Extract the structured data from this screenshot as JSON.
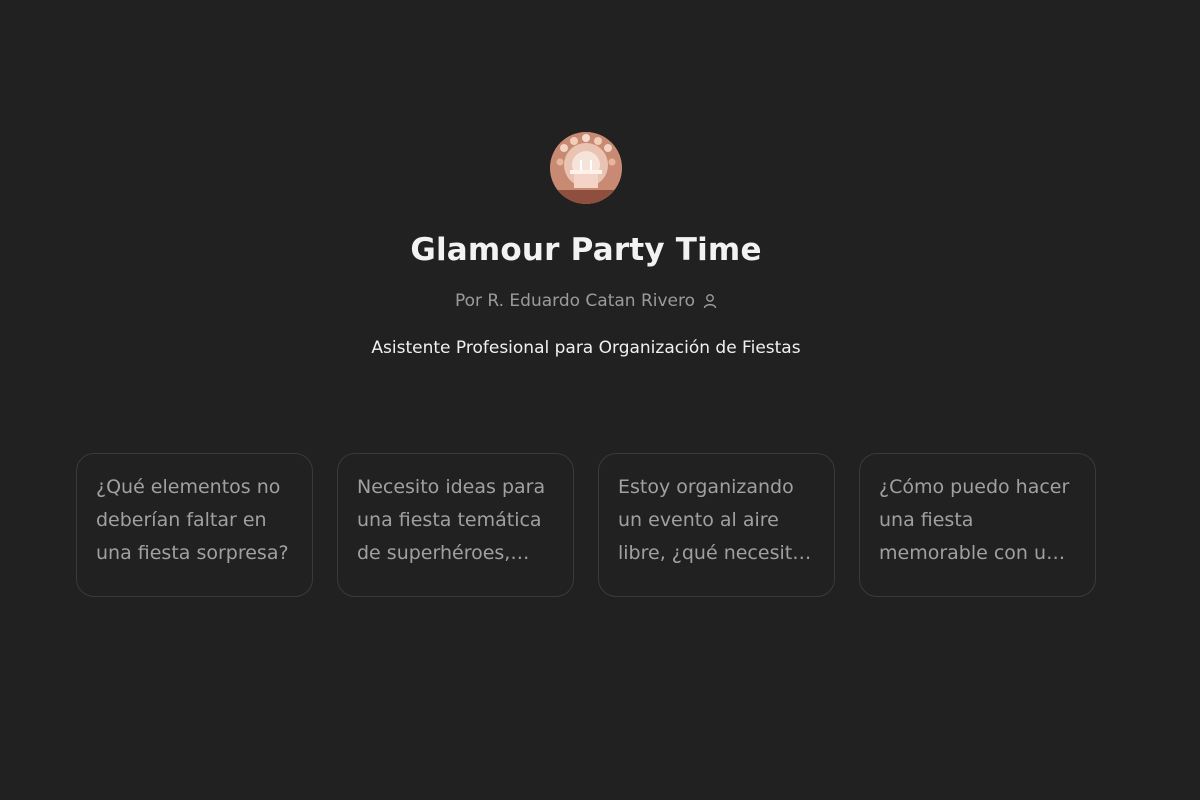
{
  "colors": {
    "background": "#212121",
    "title": "#f2f2f2",
    "muted": "#9b9b9b",
    "card_border": "#3a3a3a"
  },
  "gpt": {
    "avatar_icon": "party-table-avatar",
    "title": "Glamour Party Time",
    "author": "Por R. Eduardo Catan Rivero",
    "author_icon": "person-icon",
    "description": "Asistente Profesional para Organización de Fiestas"
  },
  "starters": [
    {
      "text": "¿Qué elementos no deberían faltar en una fiesta sorpresa?"
    },
    {
      "text": "Necesito ideas para una fiesta temática de superhéroes, ¿qué me recomiendas?"
    },
    {
      "text": "Estoy organizando un evento al aire libre, ¿qué necesito tener en cuenta?"
    },
    {
      "text": "¿Cómo puedo hacer una fiesta memorable con un presupuesto limitado?"
    }
  ]
}
